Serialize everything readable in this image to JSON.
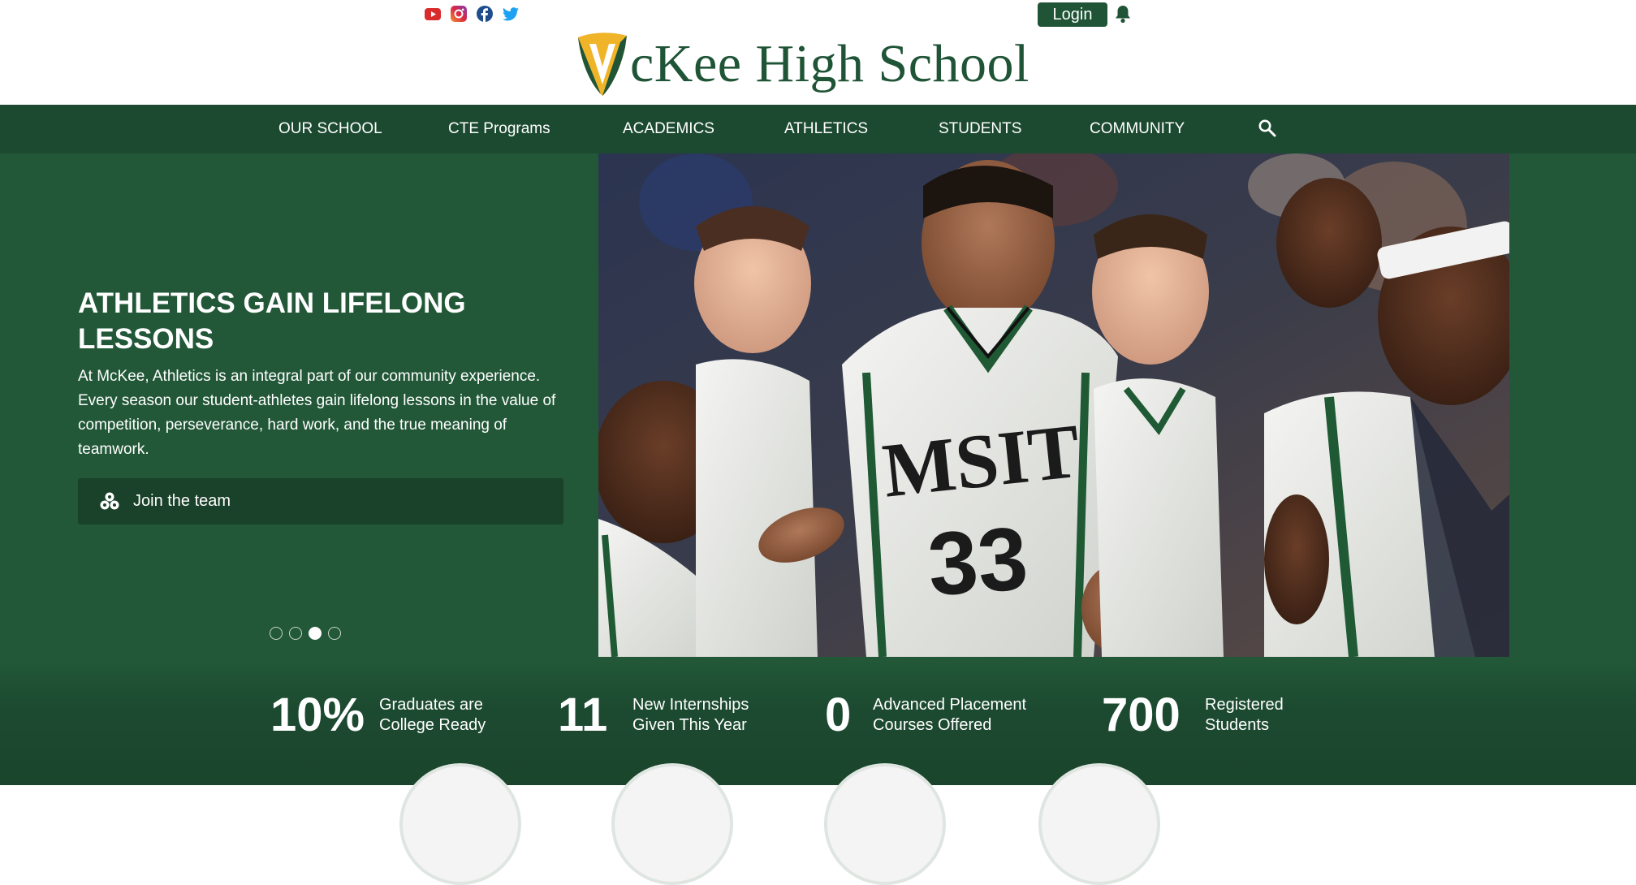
{
  "header": {
    "social": [
      {
        "name": "youtube-icon",
        "color": "#d92b2b"
      },
      {
        "name": "instagram-icon",
        "color": "#c13584"
      },
      {
        "name": "facebook-icon",
        "color": "#1f4d8c"
      },
      {
        "name": "twitter-icon",
        "color": "#1da1f2"
      }
    ],
    "login_label": "Login",
    "school_name": "McKee High School",
    "logo_text": "cKee High School",
    "colors": {
      "brand_green": "#1f5436",
      "gold": "#f0b429"
    }
  },
  "nav": {
    "items": [
      {
        "label": "OUR SCHOOL"
      },
      {
        "label": "CTE Programs"
      },
      {
        "label": "ACADEMICS"
      },
      {
        "label": "ATHLETICS"
      },
      {
        "label": "STUDENTS"
      },
      {
        "label": "COMMUNITY"
      }
    ],
    "search_icon": "search-icon"
  },
  "hero": {
    "title": "ATHLETICS GAIN LIFELONG LESSONS",
    "text": "At McKee, Athletics is an integral part of our community experience. Every season our student-athletes gain lifelong lessons in the value of competition, perseverance, hard work, and the true meaning of teamwork.",
    "button_label": "Join the team",
    "slides": 4,
    "active_slide": 3,
    "photo": {
      "jersey_text": "MSIT",
      "jersey_number": "33"
    }
  },
  "stats": [
    {
      "value": "10%",
      "line1": "Graduates are",
      "line2": "College Ready"
    },
    {
      "value": "11",
      "line1": "New Internships",
      "line2": "Given This Year"
    },
    {
      "value": "0",
      "line1": "Advanced Placement",
      "line2": "Courses Offered"
    },
    {
      "value": "700",
      "line1": "Registered",
      "line2": "Students"
    }
  ]
}
